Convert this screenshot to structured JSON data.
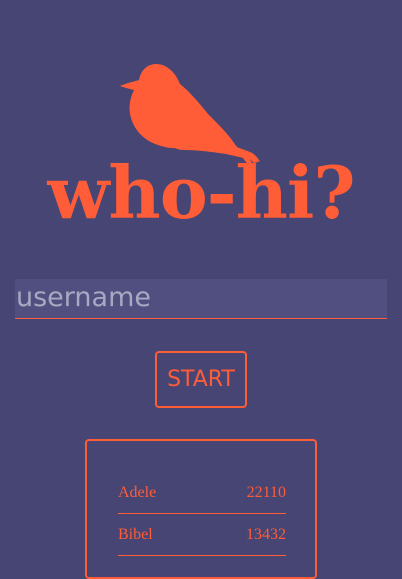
{
  "logo": {
    "text": "who-hi?",
    "icon": "bird-icon",
    "color": "#ff5c38"
  },
  "login": {
    "username_placeholder": "username",
    "start_label": "START"
  },
  "leaderboard": {
    "rows": [
      {
        "name": "Adele",
        "score": "22110"
      },
      {
        "name": "Bibel",
        "score": "13432"
      }
    ]
  },
  "colors": {
    "background": "#464573",
    "accent": "#ff5c38",
    "input_background": "#514f80"
  }
}
